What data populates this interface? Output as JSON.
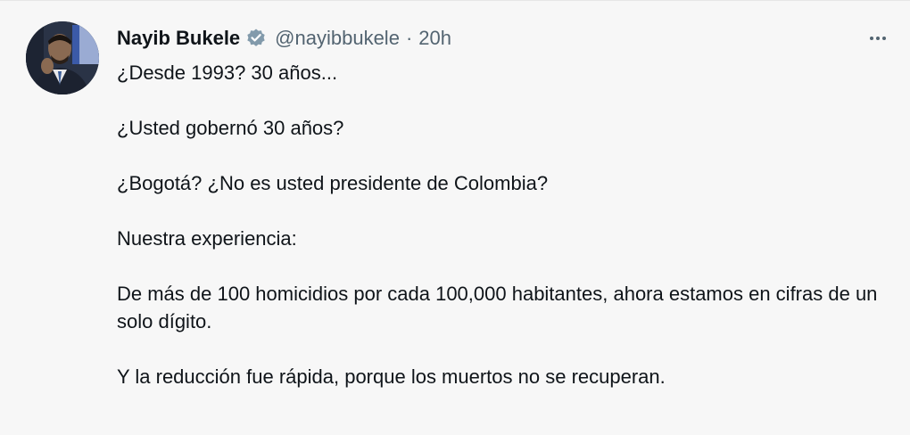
{
  "author": {
    "name": "Nayib Bukele",
    "handle": "@nayibbukele",
    "separator": "·",
    "time": "20h",
    "verified_icon": "verified-badge-icon",
    "verified_color": "#829aab"
  },
  "tweet": {
    "paragraphs": [
      "¿Desde 1993? 30 años...",
      "¿Usted gobernó 30 años?",
      "¿Bogotá? ¿No es usted presidente de Colombia?",
      "Nuestra experiencia:",
      "De más de 100 homicidios por cada 100,000 habitantes, ahora estamos en cifras de un solo dígito.",
      "Y la reducción fue rápida, porque los muertos no se recuperan."
    ]
  },
  "actions": {
    "more_icon": "more-options-icon"
  },
  "colors": {
    "background": "#f7f7f7",
    "text_primary": "#0f1419",
    "text_secondary": "#536471"
  }
}
